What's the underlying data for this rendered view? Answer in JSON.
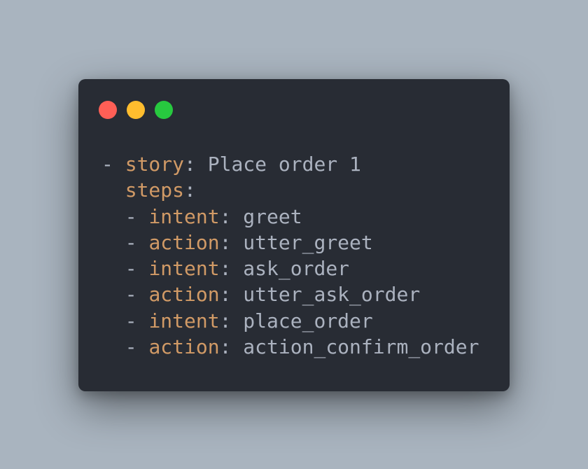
{
  "window": {
    "controls": [
      {
        "name": "close",
        "color": "#ff5f56"
      },
      {
        "name": "minimize",
        "color": "#ffbd2e"
      },
      {
        "name": "zoom",
        "color": "#27c93f"
      }
    ]
  },
  "code": {
    "colors": {
      "key": "#d19a66",
      "text": "#abb2bf",
      "background": "#282c34"
    },
    "lines": [
      {
        "indent": "",
        "dash": "-",
        "key": "story",
        "sep": ":",
        "value": " Place order 1"
      },
      {
        "indent": "  ",
        "dash": "",
        "key": "steps",
        "sep": ":",
        "value": ""
      },
      {
        "indent": "  ",
        "dash": "-",
        "key": "intent",
        "sep": ":",
        "value": " greet"
      },
      {
        "indent": "  ",
        "dash": "-",
        "key": "action",
        "sep": ":",
        "value": " utter_greet"
      },
      {
        "indent": "  ",
        "dash": "-",
        "key": "intent",
        "sep": ":",
        "value": " ask_order"
      },
      {
        "indent": "  ",
        "dash": "-",
        "key": "action",
        "sep": ":",
        "value": " utter_ask_order"
      },
      {
        "indent": "  ",
        "dash": "-",
        "key": "intent",
        "sep": ":",
        "value": " place_order"
      },
      {
        "indent": "  ",
        "dash": "-",
        "key": "action",
        "sep": ":",
        "value": " action_confirm_order"
      }
    ]
  }
}
